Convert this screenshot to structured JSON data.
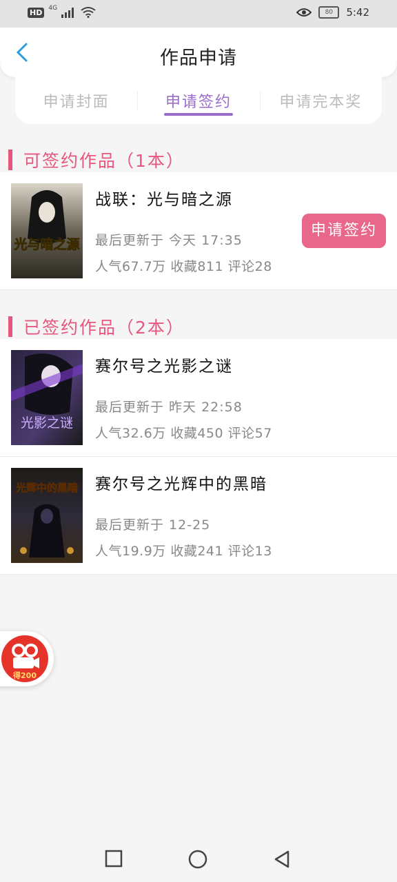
{
  "status_bar": {
    "hd": "HD",
    "network": "4G",
    "battery": "80",
    "time": "5:42"
  },
  "header": {
    "title": "作品申请",
    "back_icon": "chevron-left-icon"
  },
  "tabs": [
    {
      "label": "申请封面",
      "active": false
    },
    {
      "label": "申请签约",
      "active": true
    },
    {
      "label": "申请完本奖",
      "active": false
    }
  ],
  "sections": {
    "signable": {
      "title": "可签约作品（1本）"
    },
    "signed": {
      "title": "已签约作品（2本）"
    }
  },
  "signable_books": [
    {
      "title": "战联：光与暗之源",
      "updated": "最后更新于 今天 17:35",
      "stats": "人气67.7万 收藏811 评论28",
      "action": "申请签约",
      "cover_text": "光与暗之源"
    }
  ],
  "signed_books": [
    {
      "title": "赛尔号之光影之谜",
      "updated": "最后更新于 昨天 22:58",
      "stats": "人气32.6万 收藏450 评论57",
      "cover_text": "光影之谜"
    },
    {
      "title": "赛尔号之光辉中的黑暗",
      "updated": "最后更新于 12-25",
      "stats": "人气19.9万 收藏241 评论13",
      "cover_text": "光辉中的黑暗"
    }
  ],
  "float_badge": {
    "label": "得200",
    "icon": "video-reward-icon"
  },
  "nav_bar": {
    "icons": [
      "square-recent-icon",
      "circle-home-icon",
      "triangle-back-icon"
    ]
  },
  "colors": {
    "accent": "#e6577e",
    "tab_active": "#9b6cc9",
    "button": "#e8678a"
  }
}
